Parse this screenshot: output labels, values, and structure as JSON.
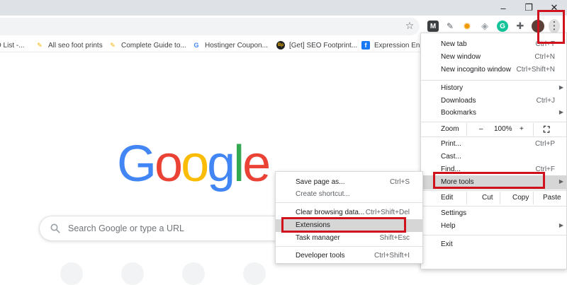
{
  "window": {
    "minimize": "–",
    "restore": "❐",
    "close": "✕"
  },
  "toolbar": {
    "star_icon": "star-icon",
    "extensions": [
      {
        "name": "m-extension-icon",
        "glyph": "M",
        "color": "#3c4043"
      },
      {
        "name": "pen-extension-icon",
        "glyph": "✎",
        "color": "#5f6368"
      },
      {
        "name": "sun-extension-icon",
        "glyph": "✹",
        "color": "#f29900"
      },
      {
        "name": "shield-extension-icon",
        "glyph": "◈",
        "color": "#9aa0a6"
      },
      {
        "name": "grammarly-icon",
        "glyph": "G",
        "color": "#15c39a"
      },
      {
        "name": "puzzle-icon",
        "glyph": "✚",
        "color": "#5f6368"
      }
    ],
    "menu_icon": "⋮"
  },
  "bookmarks": [
    {
      "label": "O List -...",
      "fav_glyph": "",
      "fav_color": "#ffffff"
    },
    {
      "label": "All seo foot prints",
      "fav_glyph": "✎",
      "fav_color": "#f4b400"
    },
    {
      "label": "Complete Guide to...",
      "fav_glyph": "✎",
      "fav_color": "#f4b400"
    },
    {
      "label": "Hostinger Coupon...",
      "fav_glyph": "G",
      "fav_color": "#ffffff"
    },
    {
      "label": "[Get] SEO Footprint...",
      "fav_glyph": "Bp",
      "fav_color": "#202124"
    },
    {
      "label": "Expression Engi",
      "fav_glyph": "f",
      "fav_color": "#1877f2"
    }
  ],
  "logo": {
    "letters": [
      "G",
      "o",
      "o",
      "g",
      "l",
      "e"
    ],
    "colors": {
      "blue": "#4285f4",
      "red": "#ea4335",
      "yellow": "#fbbc05",
      "green": "#34a853"
    }
  },
  "search": {
    "placeholder": "Search Google or type a URL"
  },
  "menu": {
    "new_tab": {
      "label": "New tab",
      "shortcut": "Ctrl+T"
    },
    "new_window": {
      "label": "New window",
      "shortcut": "Ctrl+N"
    },
    "new_incognito": {
      "label": "New incognito window",
      "shortcut": "Ctrl+Shift+N"
    },
    "history": {
      "label": "History"
    },
    "downloads": {
      "label": "Downloads",
      "shortcut": "Ctrl+J"
    },
    "bookmarks": {
      "label": "Bookmarks"
    },
    "zoom": {
      "label": "Zoom",
      "minus": "–",
      "value": "100%",
      "plus": "+"
    },
    "print": {
      "label": "Print...",
      "shortcut": "Ctrl+P"
    },
    "cast": {
      "label": "Cast..."
    },
    "find": {
      "label": "Find...",
      "shortcut": "Ctrl+F"
    },
    "more_tools": {
      "label": "More tools"
    },
    "edit": {
      "label": "Edit",
      "cut": "Cut",
      "copy": "Copy",
      "paste": "Paste"
    },
    "settings": {
      "label": "Settings"
    },
    "help": {
      "label": "Help"
    },
    "exit": {
      "label": "Exit"
    }
  },
  "submenu": {
    "save_page": {
      "label": "Save page as...",
      "shortcut": "Ctrl+S"
    },
    "create_shortcut": {
      "label": "Create shortcut..."
    },
    "clear_data": {
      "label": "Clear browsing data...",
      "shortcut": "Ctrl+Shift+Del"
    },
    "extensions": {
      "label": "Extensions"
    },
    "task_manager": {
      "label": "Task manager",
      "shortcut": "Shift+Esc"
    },
    "dev_tools": {
      "label": "Developer tools",
      "shortcut": "Ctrl+Shift+I"
    }
  },
  "highlight_color": "#d0121e"
}
